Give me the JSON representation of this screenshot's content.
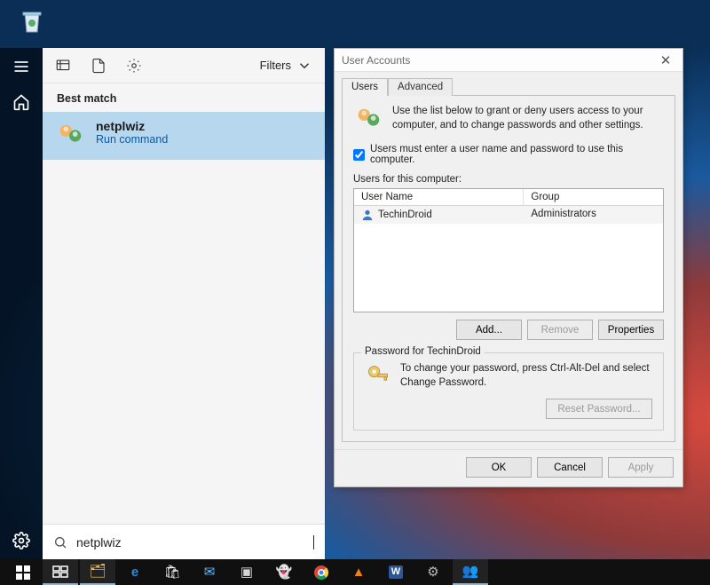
{
  "desktop": {
    "recycle_bin": "Recycle Bin"
  },
  "leftRail": {
    "hamburger": "menu-icon",
    "home": "home-icon",
    "settings": "gear-icon"
  },
  "search": {
    "filters_label": "Filters",
    "best_match": "Best match",
    "result": {
      "title": "netplwiz",
      "subtitle": "Run command"
    },
    "input_value": "netplwiz"
  },
  "dialog": {
    "title": "User Accounts",
    "tabs": {
      "users": "Users",
      "advanced": "Advanced"
    },
    "info": "Use the list below to grant or deny users access to your computer, and to change passwords and other settings.",
    "checkbox_label": "Users must enter a user name and password to use this computer.",
    "checkbox_checked": true,
    "users_for_label": "Users for this computer:",
    "columns": {
      "username": "User Name",
      "group": "Group"
    },
    "rows": [
      {
        "username": "TechinDroid",
        "group": "Administrators"
      }
    ],
    "buttons": {
      "add": "Add...",
      "remove": "Remove",
      "properties": "Properties"
    },
    "password_group": {
      "legend": "Password for TechinDroid",
      "text": "To change your password, press Ctrl-Alt-Del and select Change Password.",
      "reset": "Reset Password..."
    },
    "footer": {
      "ok": "OK",
      "cancel": "Cancel",
      "apply": "Apply"
    }
  },
  "taskbar": {
    "items": [
      "start-icon",
      "task-view-icon",
      "file-explorer-icon",
      "edge-icon",
      "store-icon",
      "mail-icon",
      "app-icon",
      "ghost-icon",
      "chrome-icon",
      "vlc-icon",
      "word-icon",
      "settings-icon",
      "user-icon"
    ]
  }
}
